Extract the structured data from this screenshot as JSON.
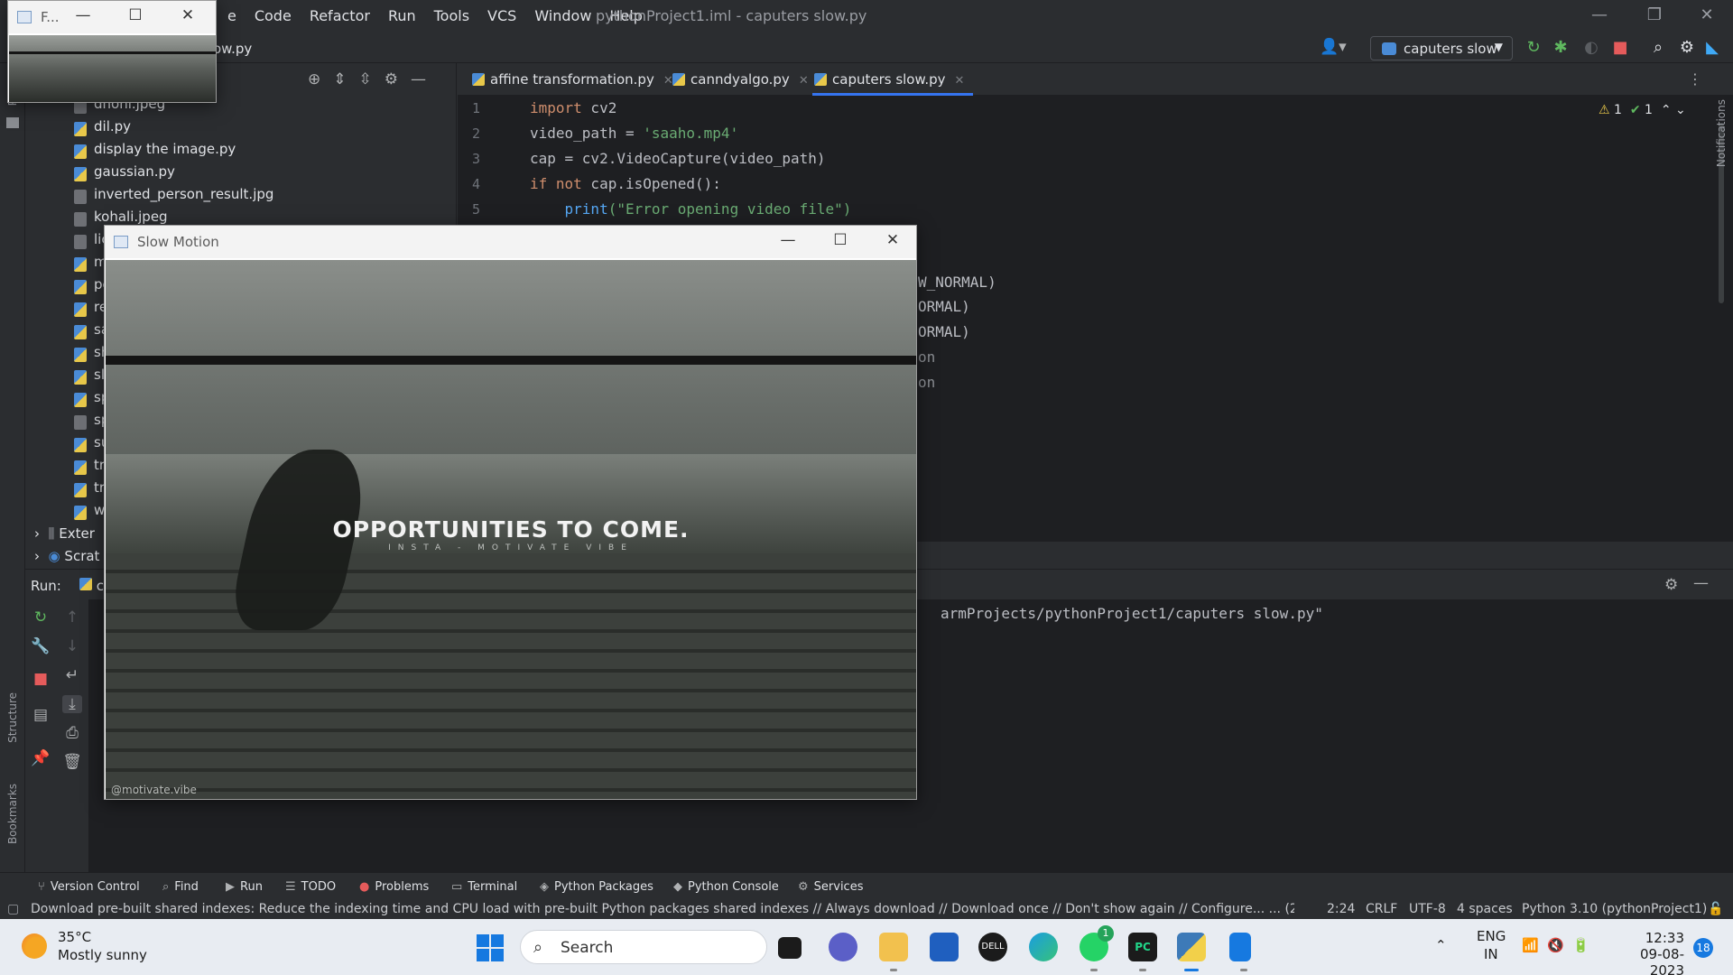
{
  "ide": {
    "menu": [
      "e",
      "Code",
      "Refactor",
      "Run",
      "Tools",
      "VCS",
      "Window",
      "Help"
    ],
    "title": "pythonProject1.iml - caputers slow.py",
    "breadcrumb": "ow.py",
    "run_config": "caputers slow"
  },
  "project_files": [
    {
      "name": "dhoni.jpeg",
      "type": "img"
    },
    {
      "name": "dil.py",
      "type": "py"
    },
    {
      "name": "display the image.py",
      "type": "py"
    },
    {
      "name": "gaussian.py",
      "type": "py"
    },
    {
      "name": "inverted_person_result.jpg",
      "type": "img"
    },
    {
      "name": "kohali.jpeg",
      "type": "img"
    },
    {
      "name": "lic",
      "type": "img"
    },
    {
      "name": "m",
      "type": "py"
    },
    {
      "name": "pe",
      "type": "py"
    },
    {
      "name": "re",
      "type": "py"
    },
    {
      "name": "sa",
      "type": "py"
    },
    {
      "name": "sh",
      "type": "py"
    },
    {
      "name": "sl",
      "type": "py"
    },
    {
      "name": "sp",
      "type": "py"
    },
    {
      "name": "sp",
      "type": "img"
    },
    {
      "name": "su",
      "type": "py"
    },
    {
      "name": "tr",
      "type": "py"
    },
    {
      "name": "tr",
      "type": "py"
    },
    {
      "name": "w",
      "type": "py"
    }
  ],
  "tree_extra": {
    "external": "Exter",
    "scratches": "Scrat"
  },
  "editor": {
    "tabs": [
      {
        "label": "affine transformation.py",
        "active": false
      },
      {
        "label": "canndyalgo.py",
        "active": false
      },
      {
        "label": "caputers slow.py",
        "active": true
      }
    ],
    "line_numbers": [
      "1",
      "2",
      "3",
      "4",
      "5"
    ],
    "lines": [
      {
        "kw": "import",
        "rest": " cv2"
      },
      {
        "pre": "video_path = ",
        "str": "'saaho.mp4'"
      },
      {
        "pre": "cap = cv2.VideoCapture(video_path)"
      },
      {
        "kw": "if not",
        "rest": " cap.isOpened():"
      },
      {
        "pre": "    ",
        "fn": "print",
        "str": "(\"Error opening video file\")"
      }
    ],
    "partial_lines": [
      "W_NORMAL)",
      "ORMAL)",
      "ORMAL)",
      "on",
      "on"
    ],
    "inspections": {
      "warnings": "1",
      "ok": "1"
    }
  },
  "run": {
    "label": "Run:",
    "tab_label": "c",
    "output": "armProjects/pythonProject1/caputers slow.py\""
  },
  "tool_tabs": [
    {
      "icon": "⑂",
      "label": "Version Control"
    },
    {
      "icon": "⌕",
      "label": "Find"
    },
    {
      "icon": "▶",
      "label": "Run"
    },
    {
      "icon": "☰",
      "label": "TODO"
    },
    {
      "icon": "●",
      "label": "Problems"
    },
    {
      "icon": "▭",
      "label": "Terminal"
    },
    {
      "icon": "◈",
      "label": "Python Packages"
    },
    {
      "icon": "◆",
      "label": "Python Console"
    },
    {
      "icon": "⚙",
      "label": "Services"
    }
  ],
  "side_labels": {
    "structure": "Structure",
    "bookmarks": "Bookmarks",
    "notifications": "Notifications",
    "project": "P"
  },
  "status": {
    "message": "Download pre-built shared indexes: Reduce the indexing time and CPU load with pre-built Python packages shared indexes // Always download // Download once // Don't show again // Configure... ... (22 minutes",
    "position": "2:24",
    "line_ending": "CRLF",
    "encoding": "UTF-8",
    "indent": "4 spaces",
    "interpreter": "Python 3.10 (pythonProject1)"
  },
  "slow_motion_window": {
    "title": "Slow Motion",
    "caption": "OPPORTUNITIES TO COME.",
    "subcaption": "INSTA - MOTIVATE VIBE",
    "watermark": "@motivate.vibe"
  },
  "frame_window": {
    "title": "F..."
  },
  "taskbar": {
    "weather_temp": "35°C",
    "weather_desc": "Mostly sunny",
    "search_label": "Search",
    "whatsapp_badge": "1",
    "lang_1": "ENG",
    "lang_2": "IN",
    "time": "12:33",
    "date": "09-08-2023",
    "notifications": "18"
  }
}
